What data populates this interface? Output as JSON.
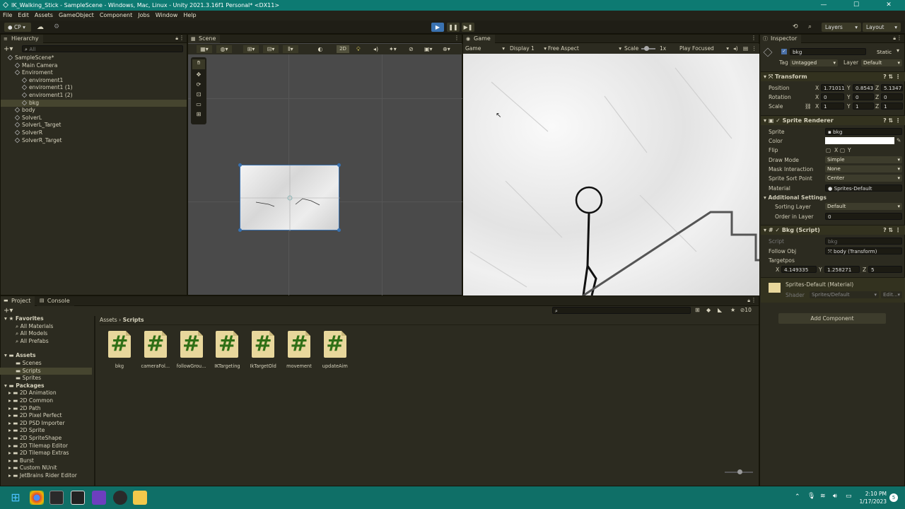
{
  "window": {
    "title": "IK_Walking_Stick - SampleScene - Windows, Mac, Linux - Unity 2021.3.16f1 Personal* <DX11>"
  },
  "menu": [
    "File",
    "Edit",
    "Assets",
    "GameObject",
    "Component",
    "Jobs",
    "Window",
    "Help"
  ],
  "toolbar": {
    "account": "CP",
    "layers": "Layers",
    "layout": "Layout"
  },
  "hierarchy": {
    "title": "Hierarchy",
    "search_placeholder": "All",
    "items": [
      {
        "label": "SampleScene*",
        "indent": 0
      },
      {
        "label": "Main Camera",
        "indent": 1
      },
      {
        "label": "Enviroment",
        "indent": 1
      },
      {
        "label": "enviroment1",
        "indent": 2
      },
      {
        "label": "enviroment1 (1)",
        "indent": 2
      },
      {
        "label": "enviroment1 (2)",
        "indent": 2
      },
      {
        "label": "bkg",
        "indent": 2,
        "selected": true
      },
      {
        "label": "body",
        "indent": 1
      },
      {
        "label": "SolverL",
        "indent": 1
      },
      {
        "label": "SolverL_Target",
        "indent": 1
      },
      {
        "label": "SolverR",
        "indent": 1
      },
      {
        "label": "SolverR_Target",
        "indent": 1
      }
    ]
  },
  "scene": {
    "title": "Scene",
    "mode2d": "2D"
  },
  "game": {
    "title": "Game",
    "display": "Game",
    "display_num": "Display 1",
    "aspect": "Free Aspect",
    "scale_label": "Scale",
    "scale_value": "1x",
    "play_focused": "Play Focused"
  },
  "inspector": {
    "title": "Inspector",
    "object_name": "bkg",
    "static": "Static",
    "tag_label": "Tag",
    "tag": "Untagged",
    "layer_label": "Layer",
    "layer": "Default",
    "transform": {
      "title": "Transform",
      "position_label": "Position",
      "rotation_label": "Rotation",
      "scale_label": "Scale",
      "position": {
        "x": "1.71011",
        "y": "0.8543",
        "z": "5.1347"
      },
      "rotation": {
        "x": "0",
        "y": "0",
        "z": "0"
      },
      "scale": {
        "x": "1",
        "y": "1",
        "z": "1"
      }
    },
    "sprite_renderer": {
      "title": "Sprite Renderer",
      "sprite_label": "Sprite",
      "sprite": "bkg",
      "color_label": "Color",
      "flip_label": "Flip",
      "flip_x": "X",
      "flip_y": "Y",
      "draw_mode_label": "Draw Mode",
      "draw_mode": "Simple",
      "mask_label": "Mask Interaction",
      "mask": "None",
      "sort_point_label": "Sprite Sort Point",
      "sort_point": "Center",
      "material_label": "Material",
      "material": "Sprites-Default",
      "additional": "Additional Settings",
      "sorting_layer_label": "Sorting Layer",
      "sorting_layer": "Default",
      "order_label": "Order in Layer",
      "order": "0"
    },
    "script": {
      "title": "Bkg (Script)",
      "script_label": "Script",
      "script": "bkg",
      "follow_label": "Follow Obj",
      "follow": "body (Transform)",
      "targetpos_label": "Targetpos",
      "targetpos": {
        "x": "4.149335",
        "y": "1.258271",
        "z": "5"
      }
    },
    "material": {
      "title": "Sprites-Default (Material)",
      "shader_label": "Shader",
      "shader": "Sprites/Default",
      "edit": "Edit..."
    },
    "add_component": "Add Component"
  },
  "project": {
    "tab": "Project",
    "console_tab": "Console",
    "hidden_count": "10",
    "favorites": {
      "title": "Favorites",
      "items": [
        "All Materials",
        "All Models",
        "All Prefabs"
      ]
    },
    "assets": {
      "title": "Assets",
      "items": [
        "Scenes",
        "Scripts",
        "Sprites"
      ]
    },
    "packages": {
      "title": "Packages",
      "items": [
        "2D Animation",
        "2D Common",
        "2D Path",
        "2D Pixel Perfect",
        "2D PSD Importer",
        "2D Sprite",
        "2D SpriteShape",
        "2D Tilemap Editor",
        "2D Tilemap Extras",
        "Burst",
        "Custom NUnit",
        "JetBrains Rider Editor"
      ]
    },
    "breadcrumb": [
      "Assets",
      "Scripts"
    ],
    "files": [
      "bkg",
      "cameraFol...",
      "followGrou...",
      "IKTargeting",
      "IkTargetOld",
      "movement",
      "updateAim"
    ]
  },
  "taskbar": {
    "time": "2:10 PM",
    "date": "1/17/2023",
    "badge": "5"
  },
  "colors": {
    "titlebar": "#0d7a72",
    "accent": "#3a72b0",
    "icon_bg": "#e8d79c",
    "hash": "#2f6f16"
  }
}
